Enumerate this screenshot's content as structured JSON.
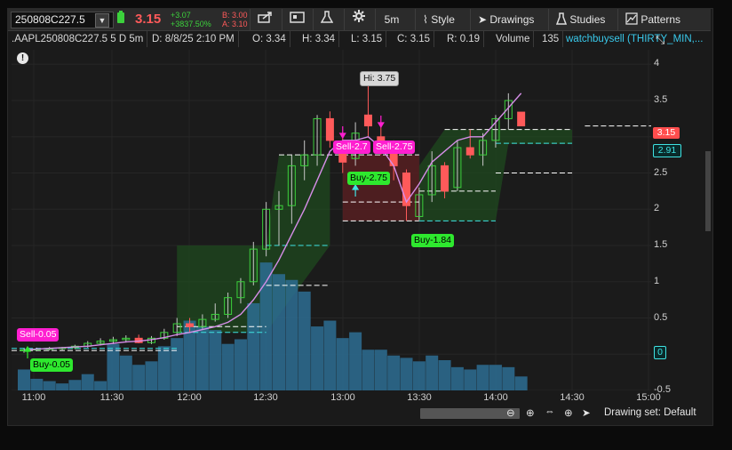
{
  "toolbar": {
    "symbol": "250808C227.5",
    "last_price": "3.15",
    "change_abs": "+3.07",
    "change_pct": "+3837.50%",
    "bid": "B: 3.00",
    "ask": "A: 3.10",
    "timeframe": "5m",
    "style_label": "Style",
    "drawings_label": "Drawings",
    "studies_label": "Studies",
    "patterns_label": "Patterns"
  },
  "infobar": {
    "symbol_desc": ".AAPL250808C227.5 5 D 5m",
    "datetime": "D: 8/8/25 2:10 PM",
    "open": "O: 3.34",
    "high": "H: 3.34",
    "low": "L: 3.15",
    "close": "C: 3.15",
    "range": "R: 0.19",
    "volume_label": "Volume",
    "volume_value": "135",
    "study_label": "watchbuysell (THIRTY_MIN,..."
  },
  "colors": {
    "up": "#3cd13c",
    "down": "#ff5a5a",
    "sell_tag": "#ff1fd0",
    "buy_tag": "#2ee82e",
    "ma_line": "#d68ee8",
    "volume": "#2d6d93",
    "zone_green": "#1f4a1f",
    "zone_red": "#5a1f22"
  },
  "chart_data": {
    "type": "candlestick",
    "x_ticks": [
      "11:00",
      "11:30",
      "12:00",
      "12:30",
      "13:00",
      "13:30",
      "14:00",
      "14:30",
      "15:00"
    ],
    "y_ticks": [
      "4",
      "3.5",
      "3",
      "2.5",
      "2",
      "1.5",
      "1",
      "0.5",
      "0",
      "-0.5"
    ],
    "ylim": [
      -0.5,
      4.2
    ],
    "candles": [
      {
        "t": "10:55",
        "o": 0.05,
        "h": 0.08,
        "l": 0.02,
        "c": 0.06
      },
      {
        "t": "11:00",
        "o": 0.06,
        "h": 0.09,
        "l": 0.04,
        "c": 0.07
      },
      {
        "t": "11:05",
        "o": 0.07,
        "h": 0.1,
        "l": 0.05,
        "c": 0.08
      },
      {
        "t": "11:10",
        "o": 0.08,
        "h": 0.1,
        "l": 0.06,
        "c": 0.09
      },
      {
        "t": "11:15",
        "o": 0.09,
        "h": 0.13,
        "l": 0.07,
        "c": 0.11
      },
      {
        "t": "11:20",
        "o": 0.11,
        "h": 0.18,
        "l": 0.09,
        "c": 0.15
      },
      {
        "t": "11:25",
        "o": 0.15,
        "h": 0.22,
        "l": 0.12,
        "c": 0.18
      },
      {
        "t": "11:30",
        "o": 0.18,
        "h": 0.24,
        "l": 0.14,
        "c": 0.2
      },
      {
        "t": "11:35",
        "o": 0.2,
        "h": 0.26,
        "l": 0.16,
        "c": 0.22
      },
      {
        "t": "11:40",
        "o": 0.22,
        "h": 0.27,
        "l": 0.15,
        "c": 0.16
      },
      {
        "t": "11:45",
        "o": 0.16,
        "h": 0.25,
        "l": 0.14,
        "c": 0.22
      },
      {
        "t": "11:50",
        "o": 0.22,
        "h": 0.35,
        "l": 0.2,
        "c": 0.3
      },
      {
        "t": "11:55",
        "o": 0.3,
        "h": 0.5,
        "l": 0.25,
        "c": 0.42
      },
      {
        "t": "12:00",
        "o": 0.42,
        "h": 0.5,
        "l": 0.3,
        "c": 0.38
      },
      {
        "t": "12:05",
        "o": 0.38,
        "h": 0.55,
        "l": 0.35,
        "c": 0.48
      },
      {
        "t": "12:10",
        "o": 0.48,
        "h": 0.7,
        "l": 0.45,
        "c": 0.55
      },
      {
        "t": "12:15",
        "o": 0.55,
        "h": 0.85,
        "l": 0.5,
        "c": 0.78
      },
      {
        "t": "12:20",
        "o": 0.78,
        "h": 1.05,
        "l": 0.7,
        "c": 1.0
      },
      {
        "t": "12:25",
        "o": 1.0,
        "h": 1.55,
        "l": 0.95,
        "c": 1.45
      },
      {
        "t": "12:30",
        "o": 1.45,
        "h": 2.1,
        "l": 1.35,
        "c": 2.0
      },
      {
        "t": "12:35",
        "o": 2.0,
        "h": 2.25,
        "l": 1.5,
        "c": 2.05
      },
      {
        "t": "12:40",
        "o": 2.05,
        "h": 2.75,
        "l": 1.8,
        "c": 2.6
      },
      {
        "t": "12:45",
        "o": 2.6,
        "h": 2.95,
        "l": 2.4,
        "c": 2.75
      },
      {
        "t": "12:50",
        "o": 2.75,
        "h": 3.3,
        "l": 2.6,
        "c": 3.25
      },
      {
        "t": "12:55",
        "o": 3.25,
        "h": 3.35,
        "l": 2.85,
        "c": 2.95
      },
      {
        "t": "13:00",
        "o": 2.78,
        "h": 3.0,
        "l": 2.5,
        "c": 2.65
      },
      {
        "t": "13:05",
        "o": 2.7,
        "h": 3.2,
        "l": 2.6,
        "c": 3.05
      },
      {
        "t": "13:10",
        "o": 3.3,
        "h": 3.75,
        "l": 3.0,
        "c": 3.15
      },
      {
        "t": "13:15",
        "o": 3.0,
        "h": 3.2,
        "l": 2.75,
        "c": 2.85
      },
      {
        "t": "13:20",
        "o": 2.85,
        "h": 2.95,
        "l": 2.4,
        "c": 2.6
      },
      {
        "t": "13:25",
        "o": 2.5,
        "h": 2.55,
        "l": 1.84,
        "c": 2.05
      },
      {
        "t": "13:30",
        "o": 1.9,
        "h": 2.3,
        "l": 1.85,
        "c": 2.2
      },
      {
        "t": "13:35",
        "o": 2.2,
        "h": 2.8,
        "l": 2.1,
        "c": 2.6
      },
      {
        "t": "13:40",
        "o": 2.6,
        "h": 2.65,
        "l": 2.15,
        "c": 2.25
      },
      {
        "t": "13:45",
        "o": 2.3,
        "h": 2.95,
        "l": 2.25,
        "c": 2.85
      },
      {
        "t": "13:50",
        "o": 2.85,
        "h": 3.1,
        "l": 2.7,
        "c": 2.75
      },
      {
        "t": "13:55",
        "o": 2.75,
        "h": 3.05,
        "l": 2.6,
        "c": 2.95
      },
      {
        "t": "14:00",
        "o": 2.95,
        "h": 3.3,
        "l": 2.85,
        "c": 3.25
      },
      {
        "t": "14:05",
        "o": 3.25,
        "h": 3.6,
        "l": 3.1,
        "c": 3.5
      },
      {
        "t": "14:10",
        "o": 3.34,
        "h": 3.34,
        "l": 3.15,
        "c": 3.15
      }
    ],
    "volume": [
      18,
      10,
      8,
      6,
      9,
      14,
      8,
      40,
      30,
      22,
      25,
      38,
      45,
      60,
      55,
      52,
      40,
      44,
      75,
      110,
      100,
      95,
      85,
      55,
      60,
      45,
      50,
      35,
      35,
      30,
      28,
      25,
      30,
      26,
      20,
      18,
      22,
      22,
      20,
      12
    ],
    "ma": [
      0.06,
      0.07,
      0.08,
      0.09,
      0.1,
      0.11,
      0.13,
      0.15,
      0.17,
      0.18,
      0.2,
      0.23,
      0.27,
      0.3,
      0.34,
      0.38,
      0.44,
      0.55,
      0.75,
      1.0,
      1.3,
      1.65,
      2.0,
      2.4,
      2.8,
      2.95,
      2.95,
      3.0,
      2.85,
      2.6,
      2.1,
      2.35,
      2.65,
      2.8,
      2.95,
      3.0,
      3.0,
      3.2,
      3.4,
      3.6
    ],
    "annotations": {
      "hi_label": "Hi: 3.75",
      "sell_labels": [
        "Sell-0.05",
        "Sell-2.7",
        "Sell-2.75"
      ],
      "buy_labels": [
        "Buy-0.05",
        "Buy-2.75",
        "Buy-1.84"
      ]
    },
    "price_flags": {
      "last": "3.15",
      "level": "2.91",
      "zero": "0"
    }
  },
  "bottombar": {
    "drawing_set": "Drawing set: Default"
  }
}
